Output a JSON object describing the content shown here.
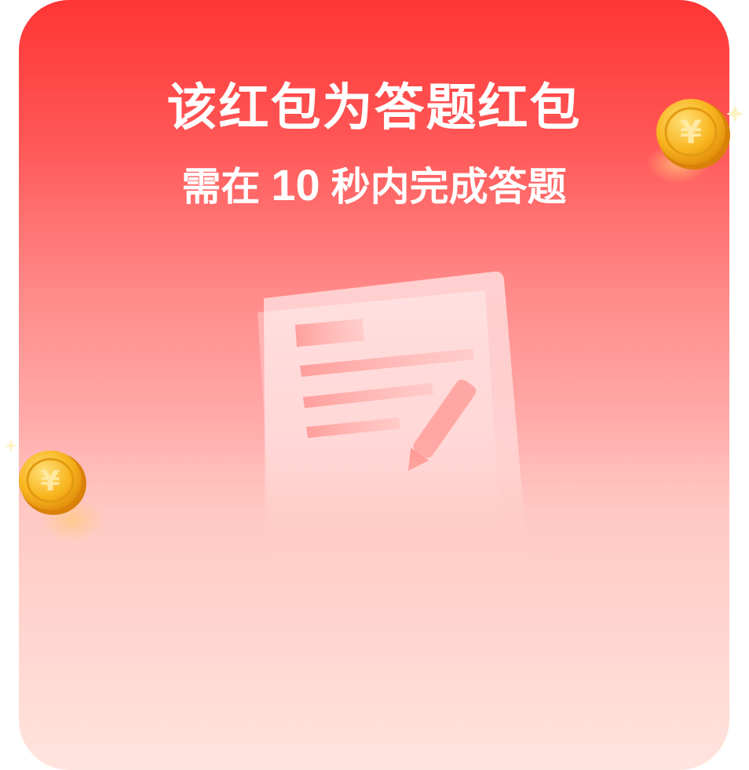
{
  "dialog": {
    "title": "该红包为答题红包",
    "subtitle_prefix": "需在",
    "subtitle_seconds": "10",
    "subtitle_suffix": "秒内完成答题"
  },
  "decorations": {
    "illustration": "document-pencil-icon",
    "coins": [
      "yuan-coin-icon",
      "yuan-coin-icon"
    ]
  },
  "colors": {
    "top": "#ff3535",
    "bottom": "#ffe4dd",
    "text": "#ffffff",
    "coin": "#f6b21c"
  }
}
